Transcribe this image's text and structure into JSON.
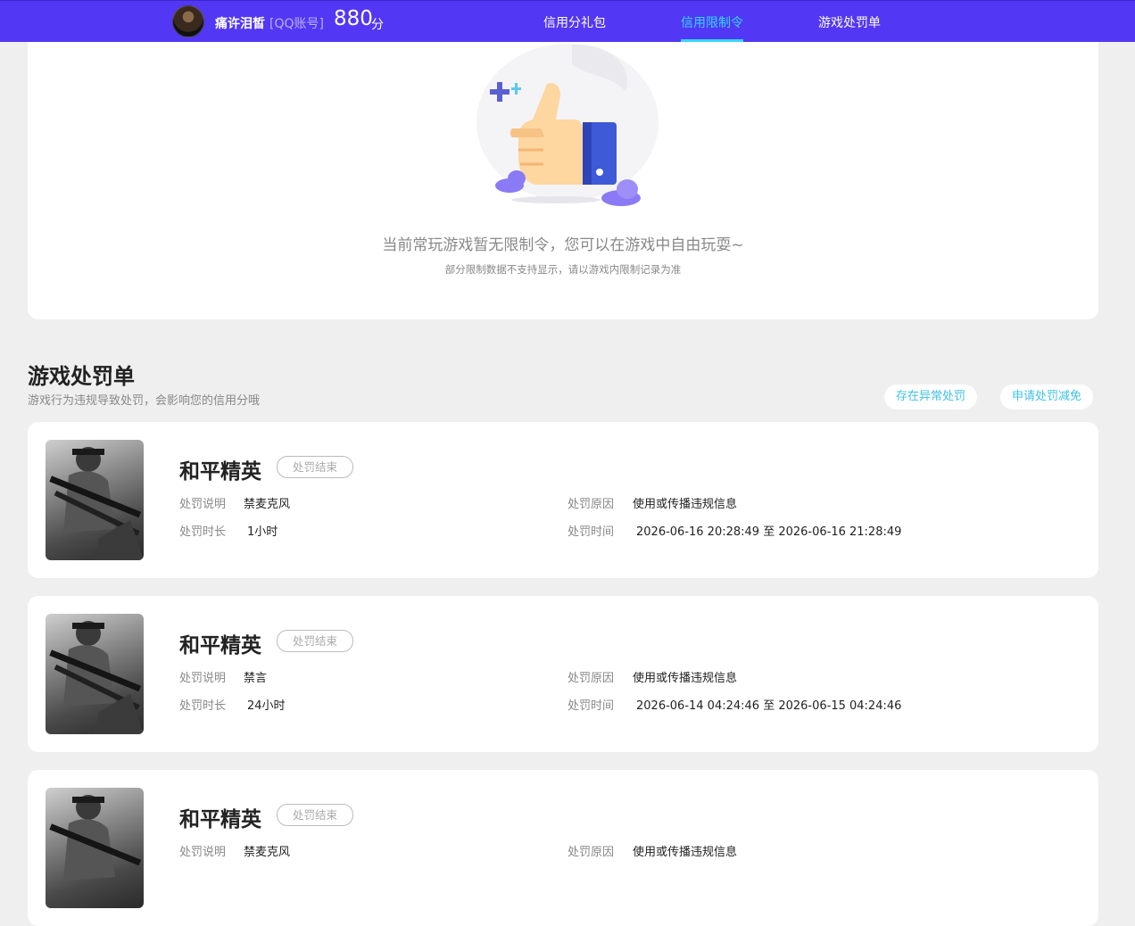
{
  "header": {
    "username": "痛许泪皙",
    "account_type": "[QQ账号]",
    "score": "880",
    "score_unit": "分",
    "tabs": [
      {
        "label": "信用分礼包",
        "active": false
      },
      {
        "label": "信用限制令",
        "active": true
      },
      {
        "label": "游戏处罚单",
        "active": false
      }
    ]
  },
  "restriction": {
    "empty_message": "当前常玩游戏暂无限制令，您可以在游戏中自由玩耍~",
    "empty_note": "部分限制数据不支持显示，请以游戏内限制记录为准"
  },
  "penalties": {
    "title": "游戏处罚单",
    "subtitle": "游戏行为违规导致处罚，会影响您的信用分哦",
    "buttons": {
      "abnormal": "存在异常处罚",
      "reduce": "申请处罚减免"
    },
    "labels": {
      "desc": "处罚说明",
      "duration": "处罚时长",
      "reason": "处罚原因",
      "time": "处罚时间"
    },
    "items": [
      {
        "game": "和平精英",
        "status": "处罚结束",
        "desc": "禁麦克风",
        "duration": "1小时",
        "reason": "使用或传播违规信息",
        "time": "2026-06-16 20:28:49 至 2026-06-16 21:28:49"
      },
      {
        "game": "和平精英",
        "status": "处罚结束",
        "desc": "禁言",
        "duration": "24小时",
        "reason": "使用或传播违规信息",
        "time": "2026-06-14 04:24:46 至 2026-06-15 04:24:46"
      },
      {
        "game": "和平精英",
        "status": "处罚结束",
        "desc": "禁麦克风",
        "duration": "",
        "reason": "使用或传播违规信息",
        "time": ""
      }
    ]
  },
  "colors": {
    "topbar": "#5237f4",
    "active_tab": "#32d9ff",
    "accent_button_text": "#3fc1e4"
  }
}
